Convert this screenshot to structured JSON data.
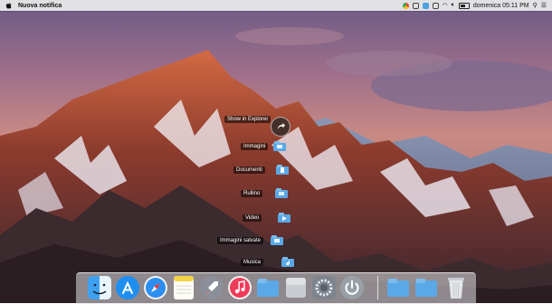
{
  "menubar": {
    "app_name": "Nuova notifica",
    "clock": "domenica 05:11 PM",
    "status_icons": [
      "chrome-icon",
      "camera-icon",
      "screen-icon",
      "notes-icon",
      "wifi-icon",
      "volume-icon",
      "battery-icon"
    ]
  },
  "stack": {
    "reveal_label": "Show in Explorer",
    "items": [
      {
        "label": "Immagini",
        "icon": "image-folder-icon"
      },
      {
        "label": "Documenti",
        "icon": "document-folder-icon"
      },
      {
        "label": "Rullino",
        "icon": "camera-roll-folder-icon"
      },
      {
        "label": "Video",
        "icon": "video-folder-icon"
      },
      {
        "label": "Immagini salvate",
        "icon": "saved-pictures-folder-icon"
      },
      {
        "label": "Musica",
        "icon": "music-folder-icon"
      }
    ]
  },
  "dock": {
    "apps": [
      "finder-icon",
      "app-store-icon",
      "safari-icon",
      "notes-icon",
      "launchpad-icon",
      "itunes-icon",
      "folder-icon",
      "blank-app-icon",
      "system-preferences-icon",
      "power-icon",
      "folder-icon",
      "folder-icon",
      "trash-icon"
    ]
  },
  "colors": {
    "accent_folder": "#5aa9e6",
    "dock_bg": "rgba(225,225,230,0.55)"
  }
}
